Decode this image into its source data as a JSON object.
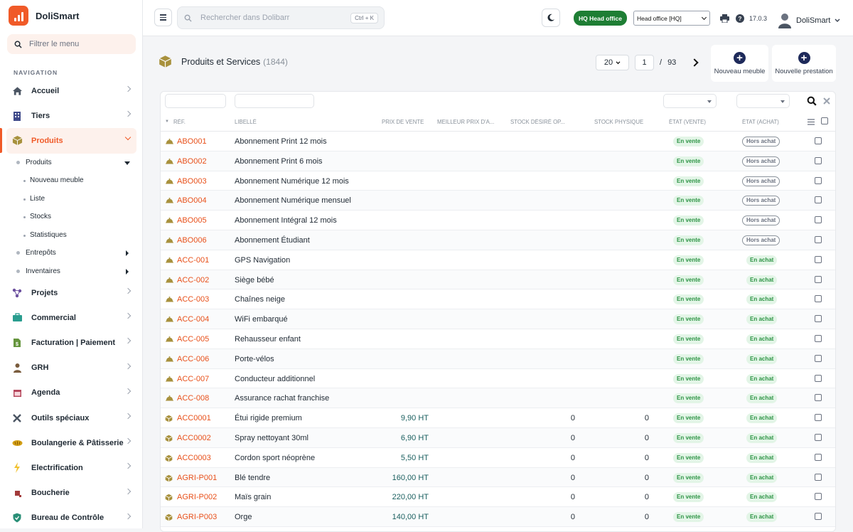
{
  "app": {
    "name": "DoliSmart"
  },
  "sidebar": {
    "filter_placeholder": "Filtrer le menu",
    "section_title": "NAVIGATION",
    "items": [
      {
        "label": "Accueil",
        "icon": "home-icon"
      },
      {
        "label": "Tiers",
        "icon": "building-icon"
      },
      {
        "label": "Produits",
        "icon": "box-icon",
        "active": true
      },
      {
        "label": "Projets",
        "icon": "project-icon"
      },
      {
        "label": "Commercial",
        "icon": "briefcase-icon"
      },
      {
        "label": "Facturation | Paiement",
        "icon": "invoice-icon"
      },
      {
        "label": "GRH",
        "icon": "user-icon"
      },
      {
        "label": "Agenda",
        "icon": "calendar-icon"
      },
      {
        "label": "Outils spéciaux",
        "icon": "tools-icon"
      },
      {
        "label": "Boulangerie & Pâtisserie",
        "icon": "bread-icon"
      },
      {
        "label": "Electrification",
        "icon": "lightning-icon"
      },
      {
        "label": "Boucherie",
        "icon": "meat-icon"
      },
      {
        "label": "Bureau de Contrôle",
        "icon": "shield-icon"
      }
    ],
    "submenu": {
      "produits": "Produits",
      "nouveau": "Nouveau meuble",
      "liste": "Liste",
      "stocks": "Stocks",
      "stats": "Statistiques",
      "entrepots": "Entrepôts",
      "inventaires": "Inventaires"
    }
  },
  "topbar": {
    "search_placeholder": "Rechercher dans Dolibarr",
    "shortcut": "Ctrl + K",
    "entity_badge": "HQ Head office",
    "entity_select": "Head office [HQ]",
    "version": "17.0.3",
    "user": "DoliSmart"
  },
  "page": {
    "title": "Produits et Services",
    "count": "(1844)",
    "per_page": "20",
    "current_page": "1",
    "separator": "/",
    "total_pages": "93",
    "btn_new_meuble": "Nouveau meuble",
    "btn_new_prestation": "Nouvelle prestation"
  },
  "table": {
    "headers": {
      "ref": "Réf.",
      "libelle": "Libellé",
      "prix": "Prix de vente",
      "meilleur": "Meilleur prix d'a...",
      "stock_desire": "Stock désiré op...",
      "stock_physique": "Stock physique",
      "etat_vente": "État (Vente)",
      "etat_achat": "État (Achat)"
    },
    "rows": [
      {
        "type": "service",
        "ref": "ABO001",
        "label": "Abonnement Print 12 mois",
        "price": "",
        "sd": "",
        "sp": "",
        "vente": "En vente",
        "achat": "Hors achat"
      },
      {
        "type": "service",
        "ref": "ABO002",
        "label": "Abonnement Print 6 mois",
        "price": "",
        "sd": "",
        "sp": "",
        "vente": "En vente",
        "achat": "Hors achat"
      },
      {
        "type": "service",
        "ref": "ABO003",
        "label": "Abonnement Numérique 12 mois",
        "price": "",
        "sd": "",
        "sp": "",
        "vente": "En vente",
        "achat": "Hors achat"
      },
      {
        "type": "service",
        "ref": "ABO004",
        "label": "Abonnement Numérique mensuel",
        "price": "",
        "sd": "",
        "sp": "",
        "vente": "En vente",
        "achat": "Hors achat"
      },
      {
        "type": "service",
        "ref": "ABO005",
        "label": "Abonnement Intégral 12 mois",
        "price": "",
        "sd": "",
        "sp": "",
        "vente": "En vente",
        "achat": "Hors achat"
      },
      {
        "type": "service",
        "ref": "ABO006",
        "label": "Abonnement Étudiant",
        "price": "",
        "sd": "",
        "sp": "",
        "vente": "En vente",
        "achat": "Hors achat"
      },
      {
        "type": "service",
        "ref": "ACC-001",
        "label": "GPS Navigation",
        "price": "",
        "sd": "",
        "sp": "",
        "vente": "En vente",
        "achat": "En achat"
      },
      {
        "type": "service",
        "ref": "ACC-002",
        "label": "Siège bébé",
        "price": "",
        "sd": "",
        "sp": "",
        "vente": "En vente",
        "achat": "En achat"
      },
      {
        "type": "service",
        "ref": "ACC-003",
        "label": "Chaînes neige",
        "price": "",
        "sd": "",
        "sp": "",
        "vente": "En vente",
        "achat": "En achat"
      },
      {
        "type": "service",
        "ref": "ACC-004",
        "label": "WiFi embarqué",
        "price": "",
        "sd": "",
        "sp": "",
        "vente": "En vente",
        "achat": "En achat"
      },
      {
        "type": "service",
        "ref": "ACC-005",
        "label": "Rehausseur enfant",
        "price": "",
        "sd": "",
        "sp": "",
        "vente": "En vente",
        "achat": "En achat"
      },
      {
        "type": "service",
        "ref": "ACC-006",
        "label": "Porte-vélos",
        "price": "",
        "sd": "",
        "sp": "",
        "vente": "En vente",
        "achat": "En achat"
      },
      {
        "type": "service",
        "ref": "ACC-007",
        "label": "Conducteur additionnel",
        "price": "",
        "sd": "",
        "sp": "",
        "vente": "En vente",
        "achat": "En achat"
      },
      {
        "type": "service",
        "ref": "ACC-008",
        "label": "Assurance rachat franchise",
        "price": "",
        "sd": "",
        "sp": "",
        "vente": "En vente",
        "achat": "En achat"
      },
      {
        "type": "product",
        "ref": "ACC0001",
        "label": "Étui rigide premium",
        "price": "9,90 HT",
        "sd": "0",
        "sp": "0",
        "vente": "En vente",
        "achat": "En achat"
      },
      {
        "type": "product",
        "ref": "ACC0002",
        "label": "Spray nettoyant 30ml",
        "price": "6,90 HT",
        "sd": "0",
        "sp": "0",
        "vente": "En vente",
        "achat": "En achat"
      },
      {
        "type": "product",
        "ref": "ACC0003",
        "label": "Cordon sport néoprène",
        "price": "5,50 HT",
        "sd": "0",
        "sp": "0",
        "vente": "En vente",
        "achat": "En achat"
      },
      {
        "type": "product",
        "ref": "AGRI-P001",
        "label": "Blé tendre",
        "price": "160,00 HT",
        "sd": "0",
        "sp": "0",
        "vente": "En vente",
        "achat": "En achat"
      },
      {
        "type": "product",
        "ref": "AGRI-P002",
        "label": "Maïs grain",
        "price": "220,00 HT",
        "sd": "0",
        "sp": "0",
        "vente": "En vente",
        "achat": "En achat"
      },
      {
        "type": "product",
        "ref": "AGRI-P003",
        "label": "Orge",
        "price": "140,00 HT",
        "sd": "0",
        "sp": "0",
        "vente": "En vente",
        "achat": "En achat"
      }
    ]
  },
  "colors": {
    "accent": "#f05a28",
    "link": "#e8501a",
    "success": "#2e9446",
    "navy": "#1e2a5a"
  }
}
